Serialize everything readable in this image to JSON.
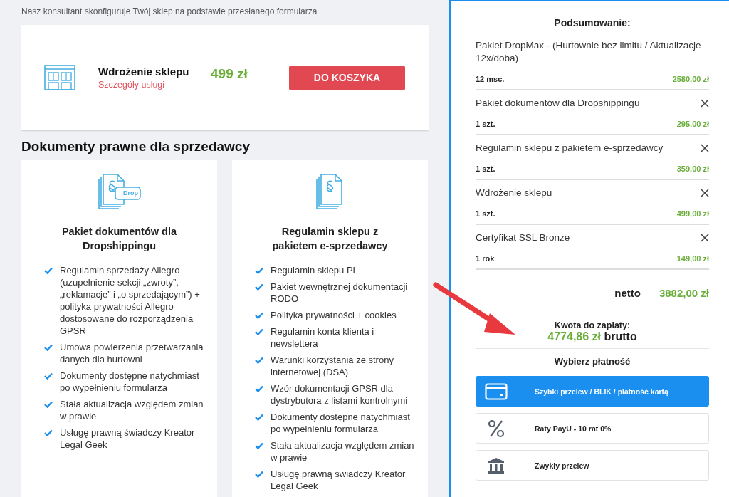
{
  "intro": "Nasz konsultant skonfiguruje Twój sklep na podstawie przesłanego formularza",
  "service": {
    "title": "Wdrożenie sklepu",
    "link": "Szczegóły usługi",
    "price": "499 zł",
    "button": "DO KOSZYKA"
  },
  "documents_heading": "Dokumenty prawne dla sprzedawcy",
  "documents": [
    {
      "kind": "drop",
      "badge": "Drop",
      "title": "Pakiet dokumentów dla Dropshippingu",
      "features": [
        "Regulamin sprzedaży Allegro (uzupełnienie sekcji „zwroty”, „reklamacje” i „o sprzedającym”) + polityka prywatności Allegro dostosowane do rozporządzenia GPSR",
        "Umowa powierzenia przetwarzania danych dla hurtowni",
        "Dokumenty dostępne natychmiast po wypełnieniu formularza",
        "Stała aktualizacja względem zmian w prawie",
        "Usługę prawną świadczy Kreator Legal Geek"
      ]
    },
    {
      "kind": "plain",
      "title": "Regulamin sklepu z pakietem e-sprzedawcy",
      "features": [
        "Regulamin sklepu PL",
        "Pakiet wewnętrznej dokumentacji RODO",
        "Polityka prywatności + cookies",
        "Regulamin konta klienta i newslettera",
        "Warunki korzystania ze strony internetowej (DSA)",
        "Wzór dokumentacji GPSR dla dystrybutora z listami kontrolnymi",
        "Dokumenty dostępne natychmiast po wypełnieniu formularza",
        "Stała aktualizacja względem zmian w prawie",
        "Usługę prawną świadczy Kreator Legal Geek"
      ]
    }
  ],
  "summary": {
    "title": "Podsumowanie:",
    "items": [
      {
        "name": "Pakiet DropMax - (Hurtownie bez limitu / Aktualizacje 12x/doba)",
        "quantity": "12 msc.",
        "price": "2580,00 zł",
        "removable": false
      },
      {
        "name": "Pakiet dokumentów dla Dropshippingu",
        "quantity": "1 szt.",
        "price": "295,00 zł",
        "removable": true
      },
      {
        "name": "Regulamin sklepu z pakietem e-sprzedawcy",
        "quantity": "1 szt.",
        "price": "359,00 zł",
        "removable": true
      },
      {
        "name": "Wdrożenie sklepu",
        "quantity": "1 szt.",
        "price": "499,00 zł",
        "removable": true
      },
      {
        "name": "Certyfikat SSL Bronze",
        "quantity": "1 rok",
        "price": "149,00 zł",
        "removable": true
      }
    ],
    "net_label": "netto",
    "net_value": "3882,00 zł",
    "due_label": "Kwota do zapłaty:",
    "due_value": "4774,86 zł",
    "due_suffix": "brutto"
  },
  "payment": {
    "title": "Wybierz płatność",
    "options": [
      {
        "kind": "card",
        "label": "Szybki przelew / BLIK / płatność kartą",
        "selected": true
      },
      {
        "kind": "percent",
        "label": "Raty PayU - 10 rat 0%",
        "selected": false
      },
      {
        "kind": "bank",
        "label": "Zwykły przelew",
        "selected": false
      }
    ]
  }
}
